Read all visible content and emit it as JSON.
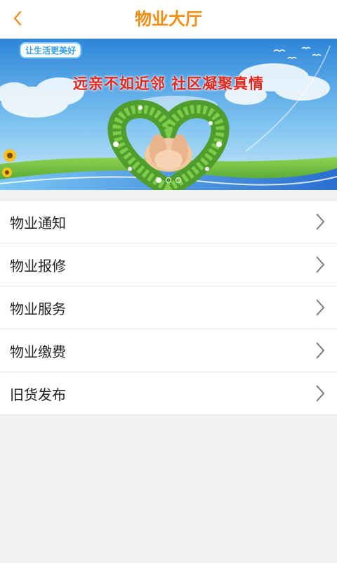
{
  "header": {
    "title": "物业大厅",
    "back_icon": "chevron-left-icon",
    "accent_color": "#f08c10"
  },
  "banner": {
    "slogan": "远亲不如近邻 社区凝聚真情",
    "logo_text": "让生活更美好",
    "dots_count": 3,
    "active_dot": 0
  },
  "menu": {
    "items": [
      {
        "label": "物业通知",
        "icon": "chevron-right-icon"
      },
      {
        "label": "物业报修",
        "icon": "chevron-right-icon"
      },
      {
        "label": "物业服务",
        "icon": "chevron-right-icon"
      },
      {
        "label": "物业缴费",
        "icon": "chevron-right-icon"
      },
      {
        "label": "旧货发布",
        "icon": "chevron-right-icon"
      }
    ]
  }
}
